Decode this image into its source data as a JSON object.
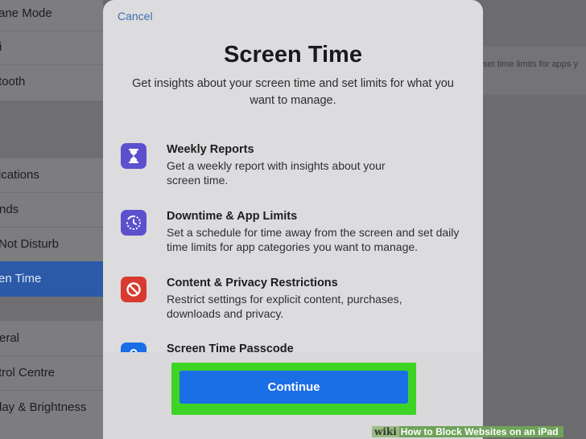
{
  "background": {
    "sidebar_items": [
      {
        "label": "ane Mode"
      },
      {
        "label": "i"
      },
      {
        "label": "tooth"
      },
      {
        "label": "ications"
      },
      {
        "label": "nds"
      },
      {
        "label": "Not Disturb"
      },
      {
        "label": "en Time"
      },
      {
        "label": "eral"
      },
      {
        "label": "trol Centre"
      },
      {
        "label": "lay & Brightness"
      }
    ],
    "right_text": "set time limits for apps y"
  },
  "modal": {
    "cancel_label": "Cancel",
    "title": "Screen Time",
    "subtitle": "Get insights about your screen time and set limits for what you want to manage.",
    "features": [
      {
        "icon": "hourglass-icon",
        "color": "#5b51cc",
        "title": "Weekly Reports",
        "description": "Get a weekly report with insights about your screen time."
      },
      {
        "icon": "downtime-icon",
        "color": "#5b51cc",
        "title": "Downtime & App Limits",
        "description": "Set a schedule for time away from the screen and set daily time limits for app categories you want to manage."
      },
      {
        "icon": "restriction-icon",
        "color": "#d93a2f",
        "title": "Content & Privacy Restrictions",
        "description": "Restrict settings for explicit content, purchases, downloads and privacy."
      },
      {
        "icon": "lock-icon",
        "color": "#1a6ee6",
        "title": "Screen Time Passcode",
        "description": ""
      }
    ],
    "continue_label": "Continue",
    "highlight_color": "#3ed425"
  },
  "watermark": {
    "wiki": "wiki",
    "text": "How to Block Websites on an iPad"
  }
}
